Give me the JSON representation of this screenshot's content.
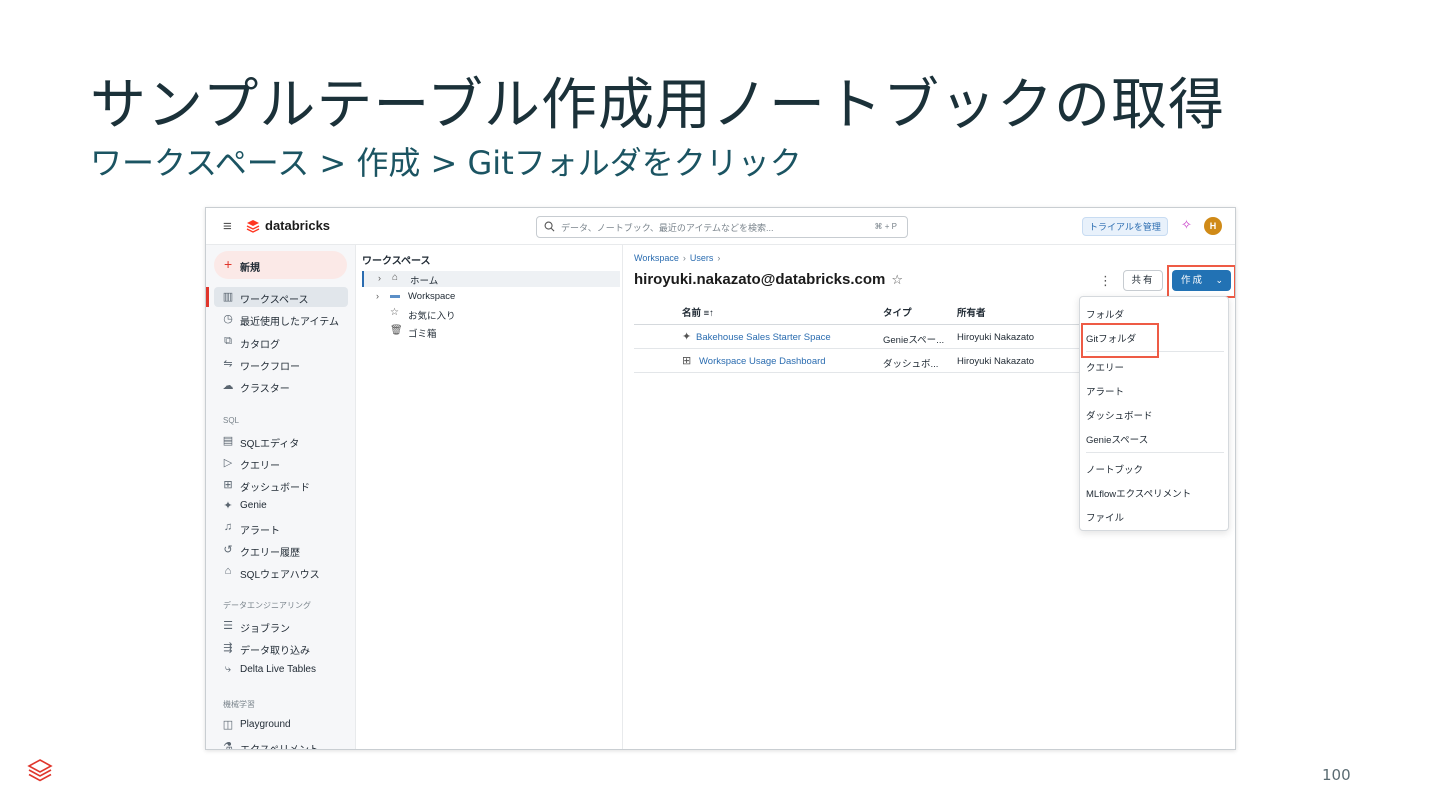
{
  "slide": {
    "title": "サンプルテーブル作成用ノートブックの取得",
    "subtitle": "ワークスペース > 作成 > Gitフォルダをクリック",
    "page_number": "100"
  },
  "app": {
    "brand": "databricks",
    "search_placeholder": "データ、ノートブック、最近のアイテムなどを検索...",
    "search_shortcut": "⌘ + P",
    "trial_button": "トライアルを管理",
    "avatar_initial": "H",
    "colors": {
      "accent": "#e0362c",
      "primary": "#2272b4",
      "highlight": "#ee5b45"
    }
  },
  "nav": {
    "new_label": "新規",
    "items": [
      {
        "icon": "workspace-icon",
        "glyph": "▥",
        "label": "ワークスペース"
      },
      {
        "icon": "clock-icon",
        "glyph": "◷",
        "label": "最近使用したアイテム"
      },
      {
        "icon": "catalog-icon",
        "glyph": "⧉",
        "label": "カタログ"
      },
      {
        "icon": "workflow-icon",
        "glyph": "⇋",
        "label": "ワークフロー"
      },
      {
        "icon": "cloud-icon",
        "glyph": "☁",
        "label": "クラスター"
      }
    ],
    "sql_section": "SQL",
    "sql_items": [
      {
        "icon": "sql-editor-icon",
        "glyph": "▤",
        "label": "SQLエディタ"
      },
      {
        "icon": "query-icon",
        "glyph": "▷",
        "label": "クエリー"
      },
      {
        "icon": "dashboard-icon",
        "glyph": "⊞",
        "label": "ダッシュボード"
      },
      {
        "icon": "genie-icon",
        "glyph": "✦",
        "label": "Genie"
      },
      {
        "icon": "bell-icon",
        "glyph": "♫",
        "label": "アラート"
      },
      {
        "icon": "history-icon",
        "glyph": "↺",
        "label": "クエリー履歴"
      },
      {
        "icon": "warehouse-icon",
        "glyph": "⌂",
        "label": "SQLウェアハウス"
      }
    ],
    "de_section": "データエンジニアリング",
    "de_items": [
      {
        "icon": "job-run-icon",
        "glyph": "☰",
        "label": "ジョブラン"
      },
      {
        "icon": "ingest-icon",
        "glyph": "⇶",
        "label": "データ取り込み"
      },
      {
        "icon": "dlt-icon",
        "glyph": "⤷",
        "label": "Delta Live Tables"
      }
    ],
    "ml_section": "機械学習",
    "ml_items": [
      {
        "icon": "playground-icon",
        "glyph": "◫",
        "label": "Playground"
      },
      {
        "icon": "experiment-icon",
        "glyph": "⚗",
        "label": "エクスペリメント"
      }
    ]
  },
  "tree": {
    "title": "ワークスペース",
    "rows": [
      {
        "chev": "›",
        "icon": "⌂",
        "label": "ホーム"
      },
      {
        "chev": "›",
        "icon": "▬",
        "label": "Workspace"
      },
      {
        "chev": "",
        "icon": "☆",
        "label": "お気に入り"
      },
      {
        "chev": "",
        "icon": "🗑",
        "label": "ゴミ箱"
      }
    ]
  },
  "main": {
    "breadcrumb": [
      "Workspace",
      "Users"
    ],
    "title": "hiroyuki.nakazato@databricks.com",
    "share_label": "共有",
    "create_label": "作成",
    "columns": [
      "名前 ≡↑",
      "タイプ",
      "所有者"
    ],
    "rows": [
      {
        "icon": "✦",
        "name": "Bakehouse Sales Starter Space",
        "type": "Genieスペー...",
        "owner": "Hiroyuki Nakazato"
      },
      {
        "icon": "⊞",
        "name": "Workspace Usage Dashboard",
        "type": "ダッシュボ...",
        "owner": "Hiroyuki Nakazato"
      }
    ]
  },
  "menu": {
    "group1": [
      "フォルダ",
      "Gitフォルダ"
    ],
    "group2": [
      "クエリー",
      "アラート",
      "ダッシュボード",
      "Genieスペース"
    ],
    "group3": [
      "ノートブック",
      "MLflowエクスペリメント",
      "ファイル"
    ]
  }
}
